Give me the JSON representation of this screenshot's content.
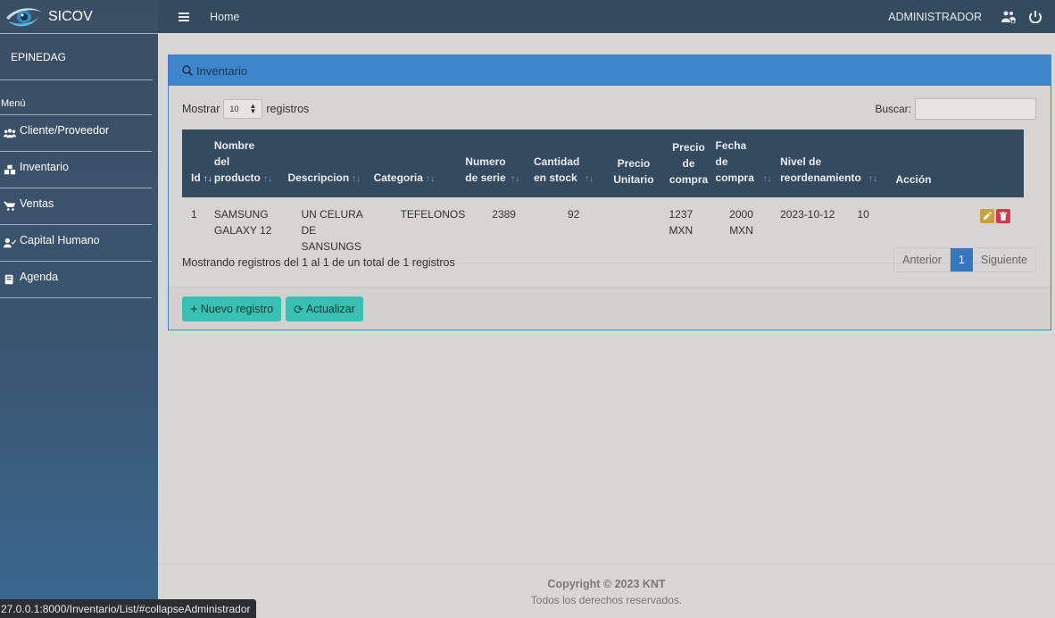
{
  "app": {
    "title": "SICOV"
  },
  "user": {
    "name": "EPINEDAG",
    "role_label": "ADMINISTRADOR"
  },
  "sidebar": {
    "menu_title": "Menú",
    "items": [
      {
        "label": "Cliente/Proveedor",
        "icon": "users-icon"
      },
      {
        "label": "Inventario",
        "icon": "boxes-icon"
      },
      {
        "label": "Ventas",
        "icon": "cart-icon"
      },
      {
        "label": "Capital Humano",
        "icon": "user-check-icon"
      },
      {
        "label": "Agenda",
        "icon": "book-icon"
      }
    ]
  },
  "topbar": {
    "home_label": "Home"
  },
  "card": {
    "title": "Inventario"
  },
  "controls": {
    "show_label": "Mostrar",
    "page_size": "10",
    "entries_label": "registros",
    "search_label": "Buscar:",
    "search_value": ""
  },
  "table": {
    "headers": [
      "Id",
      "Nombre del producto",
      "Descripcion",
      "Categoria",
      "Numero de serie",
      "Cantidad en stock",
      "Precio Unitario",
      "Precio de compra",
      "Fecha de compra",
      "Nivel de reordenamiento",
      "Acción"
    ],
    "rows": [
      {
        "id": "1",
        "nombre": "SAMSUNG GALAXY 12",
        "descripcion": "UN CELURA DE SANSUNGS",
        "categoria": "TEFELONOS",
        "numero_serie": "2389",
        "cantidad": "92",
        "precio_unitario": "",
        "precio_compra": "1237 MXN",
        "fecha_compra": "2000 MXN",
        "fecha_extra": "2023-10-12",
        "nivel": "10"
      }
    ]
  },
  "info": {
    "text": "Mostrando registros del 1 al 1 de un total de 1 registros"
  },
  "pager": {
    "prev": "Anterior",
    "current": "1",
    "next": "Siguiente"
  },
  "actions": {
    "new_label": "Nuevo registro",
    "refresh_label": "Actualizar"
  },
  "footer": {
    "copyright": "Copyright © 2023 KNT",
    "rights": "Todos los derechos reservados."
  },
  "status_bar": {
    "url": "27.0.0.1:8000/Inventario/List/#collapseAdministrador"
  }
}
